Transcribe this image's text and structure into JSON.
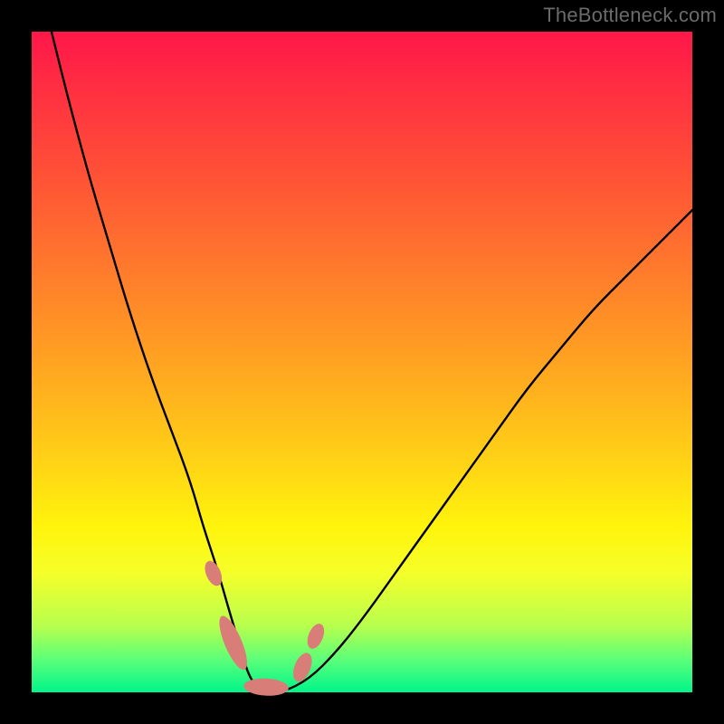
{
  "watermark": "TheBottleneck.com",
  "colors": {
    "background": "#000000",
    "watermark_text": "#6b6b6b",
    "curve": "#000000",
    "blob": "#d97d78",
    "gradient_stops": [
      "#ff1749",
      "#ff2d42",
      "#ff5236",
      "#ff7a2c",
      "#ffa321",
      "#ffcf17",
      "#fff40c",
      "#f5ff2a",
      "#b7ff4e",
      "#5cff78",
      "#00f58a"
    ]
  },
  "chart_data": {
    "type": "line",
    "title": "",
    "xlabel": "",
    "ylabel": "",
    "xlim": [
      0,
      100
    ],
    "ylim": [
      0,
      100
    ],
    "series": [
      {
        "name": "v-curve",
        "color": "#000000",
        "x": [
          3,
          6,
          9,
          12,
          15,
          18,
          21,
          24,
          26,
          28,
          30,
          31.5,
          33,
          35,
          38,
          42,
          46,
          50,
          55,
          60,
          65,
          70,
          75,
          80,
          85,
          90,
          95,
          100
        ],
        "values": [
          100,
          88,
          77,
          67,
          57,
          48,
          40,
          32,
          25,
          19,
          12,
          7,
          2,
          0,
          0,
          2,
          6,
          11,
          18,
          25,
          32,
          39,
          46,
          52,
          58,
          63,
          68,
          73
        ]
      }
    ],
    "markers": [
      {
        "name": "left-upper-blob",
        "x": 27.5,
        "y": 18,
        "rx": 1.1,
        "ry": 2.0,
        "rotation_deg": -23
      },
      {
        "name": "left-main-blob",
        "x": 30.5,
        "y": 7.5,
        "rx": 1.3,
        "ry": 4.4,
        "rotation_deg": -23
      },
      {
        "name": "bottom-blob",
        "x": 35.5,
        "y": 0.8,
        "rx": 3.4,
        "ry": 1.3,
        "rotation_deg": 3
      },
      {
        "name": "right-lower-blob",
        "x": 41.0,
        "y": 3.8,
        "rx": 1.2,
        "ry": 2.3,
        "rotation_deg": 22
      },
      {
        "name": "right-upper-blob",
        "x": 43.0,
        "y": 8.5,
        "rx": 1.1,
        "ry": 2.0,
        "rotation_deg": 22
      }
    ]
  }
}
